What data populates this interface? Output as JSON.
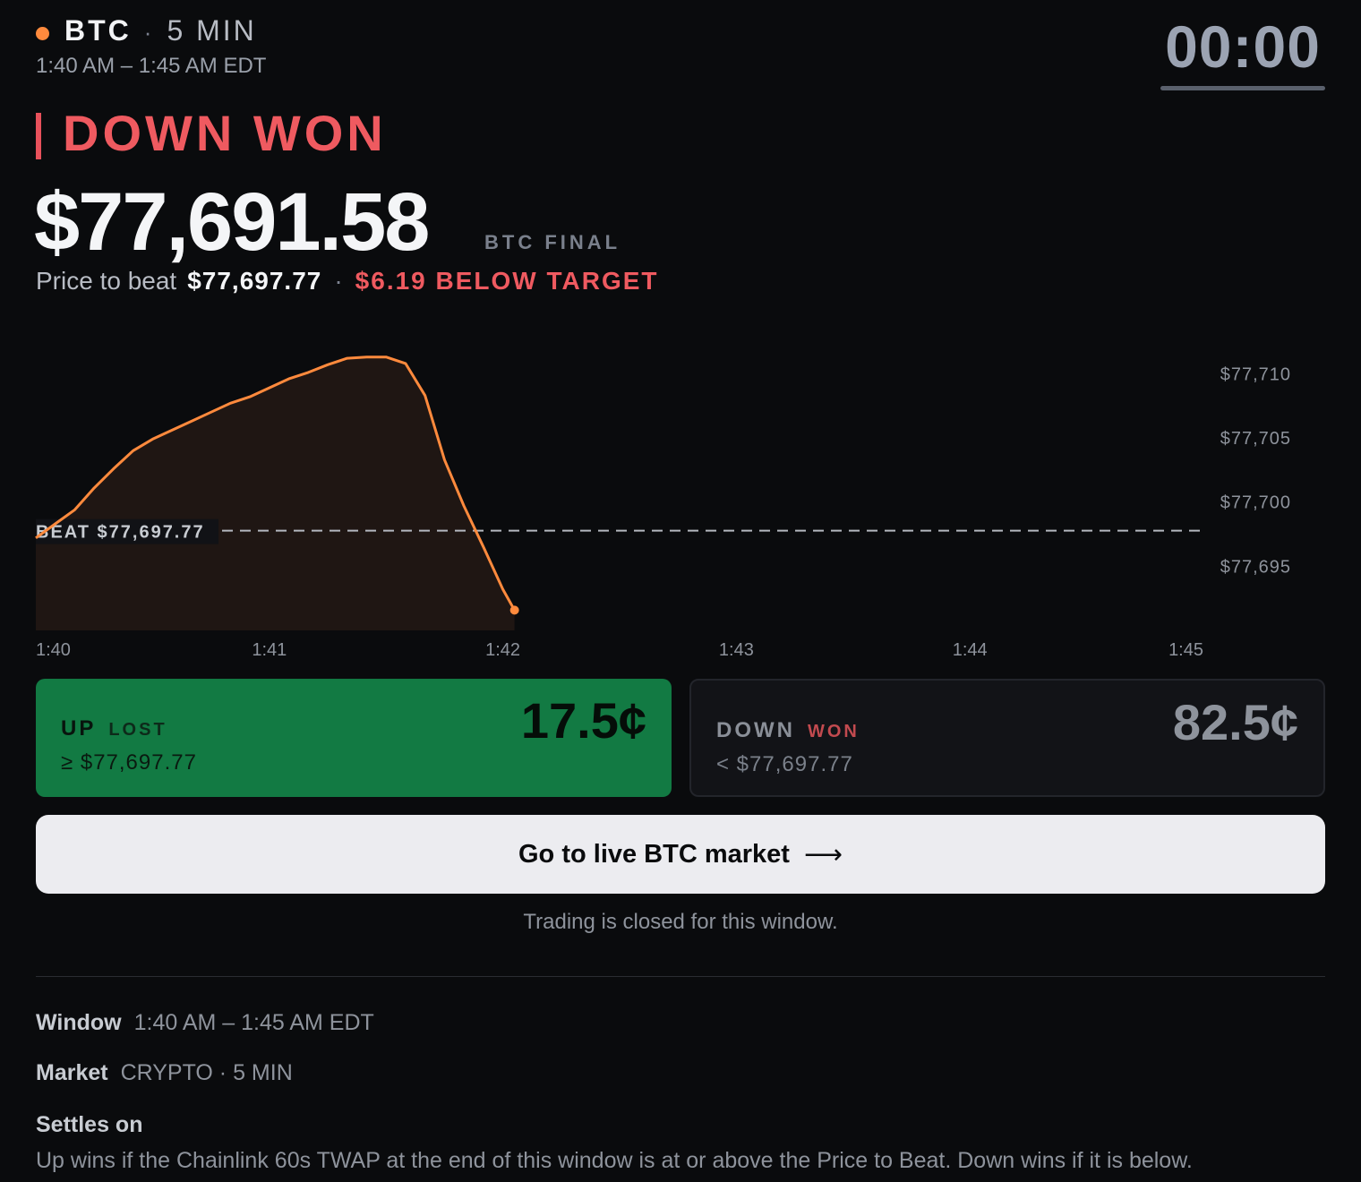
{
  "header": {
    "asset": "BTC",
    "separator": "·",
    "duration": "5 MIN",
    "time_range": "1:40 AM – 1:45 AM EDT",
    "countdown": "00:00"
  },
  "result": {
    "label": "DOWN WON",
    "final_price": "$77,691.58",
    "final_label": "BTC FINAL",
    "beat_label": "Price to beat",
    "beat_value": "$77,697.77",
    "separator": "·",
    "diff_text": "$6.19 BELOW TARGET"
  },
  "chart_data": {
    "type": "line",
    "ylim": [
      77690,
      77714
    ],
    "y_ticks": [
      {
        "value": 77710,
        "label": "$77,710"
      },
      {
        "value": 77705,
        "label": "$77,705"
      },
      {
        "value": 77700,
        "label": "$77,700"
      },
      {
        "value": 77695,
        "label": "$77,695"
      }
    ],
    "x_range": [
      "1:40",
      "1:45"
    ],
    "x_ticks": [
      "1:40",
      "1:41",
      "1:42",
      "1:43",
      "1:44",
      "1:45"
    ],
    "beat_line": {
      "value": 77697.77,
      "label": "BEAT $77,697.77"
    },
    "series": [
      {
        "x": [
          "1:40:00",
          "1:40:05",
          "1:40:10",
          "1:40:15",
          "1:40:20",
          "1:40:25",
          "1:40:30",
          "1:40:35",
          "1:40:40",
          "1:40:45",
          "1:40:50",
          "1:40:55",
          "1:41:00",
          "1:41:05",
          "1:41:10",
          "1:41:15",
          "1:41:20",
          "1:41:25",
          "1:41:30",
          "1:41:35",
          "1:41:40",
          "1:41:45",
          "1:41:50",
          "1:41:55",
          "1:42:00",
          "1:42:03"
        ],
        "y": [
          77697.2,
          77698.3,
          77699.4,
          77701.1,
          77702.6,
          77704.0,
          77704.9,
          77705.6,
          77706.3,
          77707.0,
          77707.7,
          77708.2,
          77708.9,
          77709.6,
          77710.1,
          77710.7,
          77711.2,
          77711.3,
          77711.3,
          77710.8,
          77708.3,
          77703.3,
          77699.7,
          77696.5,
          77693.2,
          77691.58
        ]
      }
    ]
  },
  "options": {
    "up": {
      "label": "UP",
      "status": "LOST",
      "condition": "≥ $77,697.77",
      "price": "17.5¢",
      "color": "#127a43"
    },
    "down": {
      "label": "DOWN",
      "status": "WON",
      "condition": "< $77,697.77",
      "price": "82.5¢"
    }
  },
  "cta": {
    "label": "Go to live BTC market",
    "arrow": "⟶"
  },
  "closed_text": "Trading is closed for this window.",
  "details": {
    "window_label": "Window",
    "window_value": "1:40 AM – 1:45 AM EDT",
    "market_label": "Market",
    "market_value": "CRYPTO · 5 MIN",
    "settles_label": "Settles on",
    "settles_text": "Up wins if the Chainlink 60s TWAP at the end of this window is at or above the Price to Beat. Down wins if it is below."
  },
  "colors": {
    "accent_orange": "#ff8a3d",
    "down_red": "#ef5a60",
    "up_green": "#127a43",
    "background": "#0a0b0d"
  }
}
